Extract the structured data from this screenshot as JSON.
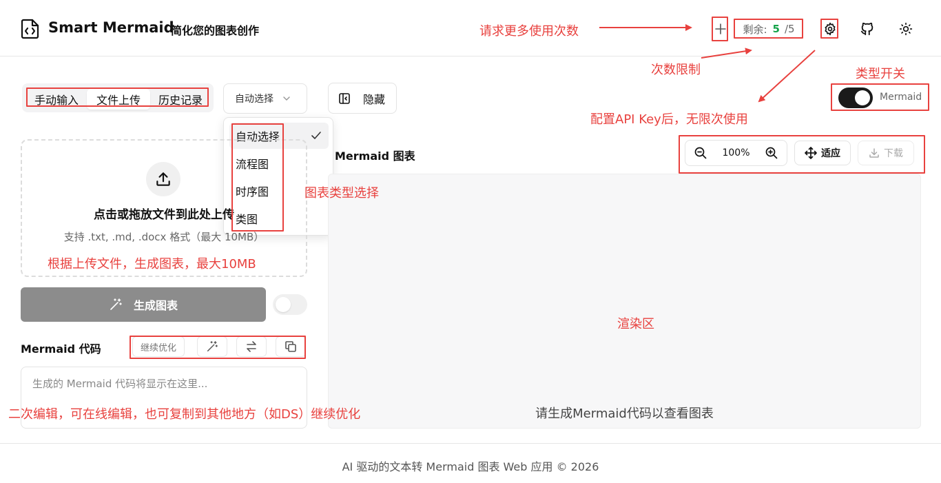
{
  "header": {
    "title": "Smart Mermaid",
    "subtitle": "简化您的图表创作",
    "quota_label": "剩余:",
    "quota_remaining": "5",
    "quota_total": "/5"
  },
  "input_tabs": [
    "手动输入",
    "文件上传",
    "历史记录"
  ],
  "type_select": {
    "value": "自动选择",
    "options": [
      "自动选择",
      "流程图",
      "时序图",
      "类图"
    ]
  },
  "hide_button": "隐藏",
  "upload": {
    "title": "点击或拖放文件到此处上传",
    "hint": "支持 .txt, .md, .docx 格式（最大 10MB）"
  },
  "generate_button": "生成图表",
  "code": {
    "label": "Mermaid 代码",
    "continue_label": "继续优化",
    "placeholder": "生成的 Mermaid 代码将显示在这里..."
  },
  "chart_panel": {
    "title": "Mermaid 图表",
    "zoom": "100%",
    "fit": "适应",
    "download": "下载",
    "placeholder": "请生成Mermaid代码以查看图表"
  },
  "type_switch_label": "Mermaid",
  "annotations": {
    "more_uses": "请求更多使用次数",
    "quota_limit": "次数限制",
    "api_key": "配置API Key后，无限次使用",
    "type_switch": "类型开关",
    "chart_type": "图表类型选择",
    "upload_note": "根据上传文件，生成图表，最大10MB",
    "render_area": "渲染区",
    "edit_note": "二次编辑，可在线编辑，也可复制到其他地方（如DS）继续优化"
  },
  "footer": "AI 驱动的文本转 Mermaid 图表 Web 应用 © 2026",
  "colors": {
    "annotation": "#e8413e",
    "quota_number": "#16a34a",
    "generate_disabled": "#8c8c8c"
  },
  "icons": [
    "file-code-icon",
    "plus-icon",
    "gear-icon",
    "github-icon",
    "sun-icon",
    "panel-collapse-icon",
    "chevron-down-icon",
    "check-icon",
    "upload-icon",
    "magic-wand-icon",
    "swap-icon",
    "copy-icon",
    "zoom-out-icon",
    "zoom-in-icon",
    "move-icon",
    "download-icon"
  ]
}
